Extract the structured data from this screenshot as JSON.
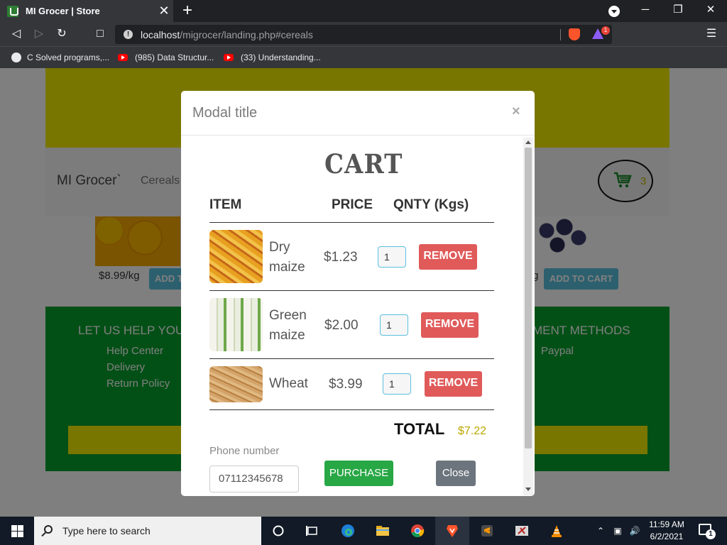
{
  "browser": {
    "tab_title": "MI Grocer | Store",
    "tab_close": "✕",
    "new_tab": "+",
    "url_host": "localhost",
    "url_path": "/migrocer/landing.php#cereals",
    "brave_badge": "1",
    "window_minimize": "─",
    "window_restore": "❐",
    "window_close": "✕",
    "bookmarks": [
      {
        "label": "C Solved programs,..."
      },
      {
        "label": "(985) Data Structur..."
      },
      {
        "label": "(33) Understanding..."
      }
    ]
  },
  "site": {
    "brand": "MI Grocer`",
    "nav_link": "Cereals",
    "cart_count": "3",
    "product_left_price": "$8.99/kg",
    "product_left_btn": "ADD TO CART",
    "product_right_price": "g",
    "product_right_btn": "ADD TO CART",
    "footer_help_title": "LET US HELP YOU",
    "footer_help_links": [
      "Help Center",
      "Delivery",
      "Return Policy"
    ],
    "footer_pay_title": "MENT METHODS",
    "footer_pay_links": [
      "Paypal"
    ]
  },
  "modal": {
    "title": "Modal title",
    "close_x": "×",
    "heading": "CART",
    "columns": {
      "item": "ITEM",
      "price": "PRICE",
      "qty": "QNTY (Kgs)"
    },
    "items": [
      {
        "name_line1": "Dry",
        "name_line2": "maize",
        "price": "$1.23",
        "qty": "1",
        "remove": "REMOVE"
      },
      {
        "name_line1": "Green",
        "name_line2": "maize",
        "price": "$2.00",
        "qty": "1",
        "remove": "REMOVE"
      },
      {
        "name_line1": "Wheat",
        "name_line2": "",
        "price": "$3.99",
        "qty": "1",
        "remove": "REMOVE"
      }
    ],
    "total_label": "TOTAL",
    "total_value": "$7.22",
    "phone_label": "Phone number",
    "phone_value": "07112345678",
    "purchase": "PURCHASE",
    "close": "Close"
  },
  "taskbar": {
    "search_placeholder": "Type here to search",
    "time": "11:59 AM",
    "date": "6/2/2021",
    "notification_count": "1"
  },
  "colors": {
    "banner_yellow": "#f2ed00",
    "footer_green": "#06a02c",
    "remove_red": "#e05a5a",
    "purchase_green": "#28a745",
    "total_gold": "#bba700"
  }
}
